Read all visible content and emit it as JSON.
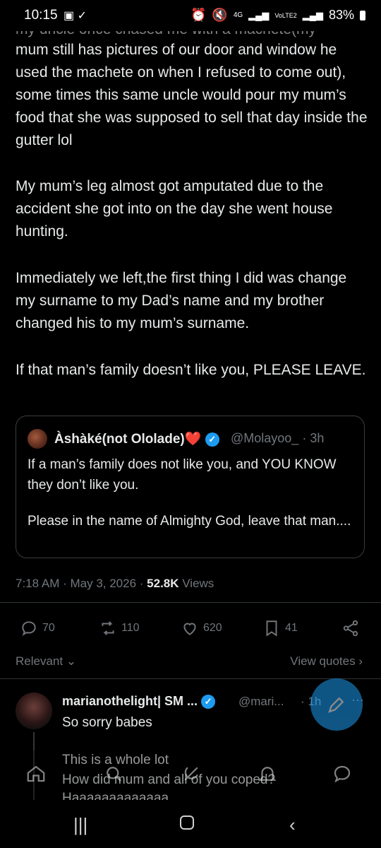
{
  "status_bar": {
    "time": "10:15",
    "network": "4G",
    "volte": "VoLTE2",
    "battery": "83%"
  },
  "tweet": {
    "cut_line": "my uncle once chased me with a machete(my",
    "paragraphs": [
      "mum still has pictures of our door and window he used the machete on when I refused to come out), some times this same uncle would pour my mum’s food that she was supposed to sell that day inside the gutter lol",
      "My mum’s leg almost got amputated due to the accident she got into on the day she went house hunting.",
      "Immediately we left,the first thing I did was change my surname to my Dad’s name and my brother changed his to my mum’s surname.",
      "If that man’s family doesn’t like you, PLEASE LEAVE."
    ]
  },
  "quote": {
    "author_name": "Àshàké(not Ololade)❤️",
    "handle_time": "@Molayoo_ · 3h",
    "text_1": "If a man’s family does not like you, and YOU KNOW they don’t like you.",
    "text_2": "Please in the name of Almighty God, leave that man...."
  },
  "meta": {
    "time": "7:18 AM · May 3, 2026 · ",
    "views_count": "52.8K",
    "views_label": " Views"
  },
  "actions": {
    "replies": "70",
    "reposts": "110",
    "likes": "620",
    "bookmarks": "41"
  },
  "sort": {
    "relevant": "Relevant",
    "view_quotes": "View quotes"
  },
  "reply": {
    "name": "marianothelight| SM ...",
    "handle": "@mari...",
    "time": "· 1h",
    "line1": "So sorry babes",
    "line2": "This is a whole lot",
    "line3": "How did mum and all of you coped?",
    "line4": "Haaaaaaaaaaaaa"
  },
  "colors": {
    "accent": "#1d9bf0",
    "muted": "#71767b",
    "text": "#e7e9ea",
    "like": "#f91880"
  }
}
